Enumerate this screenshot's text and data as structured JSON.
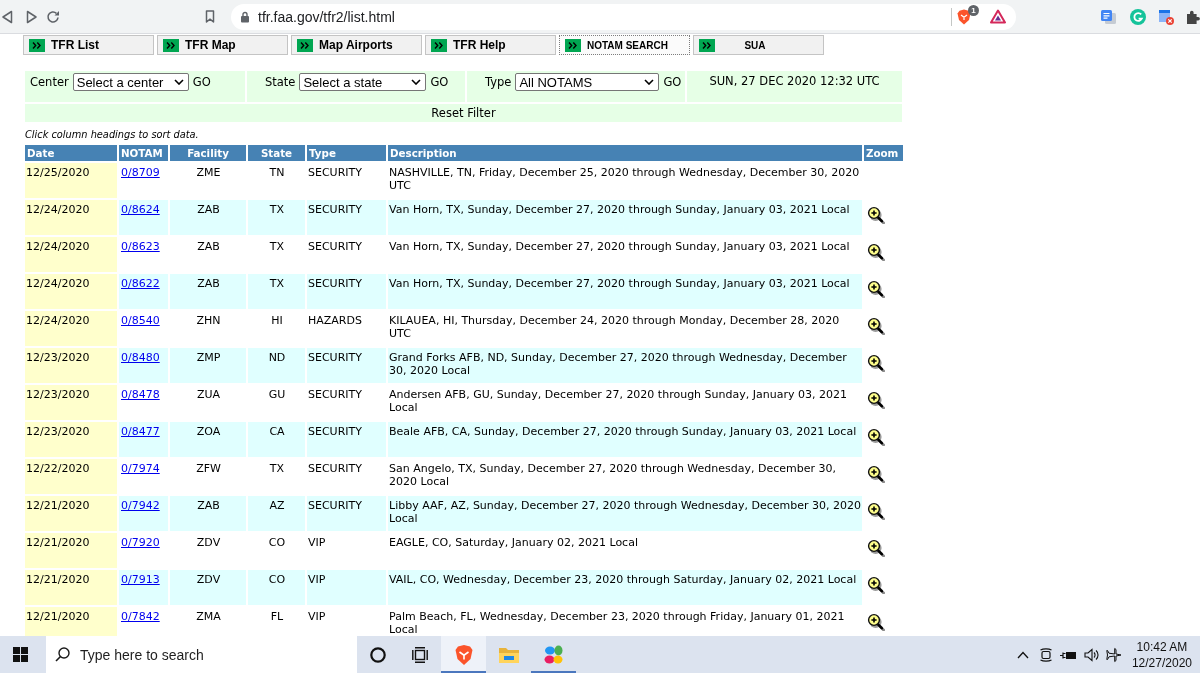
{
  "browser": {
    "url": "tfr.faa.gov/tfr2/list.html",
    "shield_count": "1"
  },
  "nav_tabs": [
    {
      "label": "TFR List",
      "kind": "main",
      "selected": false
    },
    {
      "label": "TFR Map",
      "kind": "main",
      "selected": false
    },
    {
      "label": "Map Airports",
      "kind": "main",
      "selected": false
    },
    {
      "label": "TFR Help",
      "kind": "main",
      "selected": false
    },
    {
      "label": "NOTAM SEARCH",
      "kind": "compact",
      "selected": true
    },
    {
      "label": "SUA",
      "kind": "compact",
      "selected": false
    }
  ],
  "filters": [
    {
      "label": "Center",
      "value": "Select a center",
      "button": "GO"
    },
    {
      "label": "State",
      "value": "Select a state",
      "button": "GO"
    },
    {
      "label": "Type",
      "value": "All NOTAMS",
      "button": "GO"
    }
  ],
  "timestamp": "SUN, 27 DEC 2020 12:32 UTC",
  "reset_button": "Reset Filter",
  "sort_hint": "Click column headings to sort data.",
  "table": {
    "columns": [
      "Date",
      "NOTAM",
      "Facility",
      "State",
      "Type",
      "Description",
      "Zoom"
    ],
    "rows": [
      {
        "date": "12/25/2020",
        "notam": "0/8709",
        "facility": "ZME",
        "state": "TN",
        "type": "SECURITY",
        "description": "NASHVILLE, TN, Friday, December 25, 2020 through Wednesday, December 30, 2020 UTC",
        "zoom": false
      },
      {
        "date": "12/24/2020",
        "notam": "0/8624",
        "facility": "ZAB",
        "state": "TX",
        "type": "SECURITY",
        "description": "Van Horn, TX, Sunday, December 27, 2020 through Sunday, January 03, 2021 Local",
        "zoom": true
      },
      {
        "date": "12/24/2020",
        "notam": "0/8623",
        "facility": "ZAB",
        "state": "TX",
        "type": "SECURITY",
        "description": "Van Horn, TX, Sunday, December 27, 2020 through Sunday, January 03, 2021 Local",
        "zoom": true
      },
      {
        "date": "12/24/2020",
        "notam": "0/8622",
        "facility": "ZAB",
        "state": "TX",
        "type": "SECURITY",
        "description": "Van Horn, TX, Sunday, December 27, 2020 through Sunday, January 03, 2021 Local",
        "zoom": true
      },
      {
        "date": "12/24/2020",
        "notam": "0/8540",
        "facility": "ZHN",
        "state": "HI",
        "type": "HAZARDS",
        "description": "KILAUEA, HI, Thursday, December 24, 2020 through Monday, December 28, 2020 UTC",
        "zoom": true
      },
      {
        "date": "12/23/2020",
        "notam": "0/8480",
        "facility": "ZMP",
        "state": "ND",
        "type": "SECURITY",
        "description": "Grand Forks AFB, ND, Sunday, December 27, 2020 through Wednesday, December 30, 2020 Local",
        "zoom": true
      },
      {
        "date": "12/23/2020",
        "notam": "0/8478",
        "facility": "ZUA",
        "state": "GU",
        "type": "SECURITY",
        "description": "Andersen AFB, GU, Sunday, December 27, 2020 through Sunday, January 03, 2021 Local",
        "zoom": true
      },
      {
        "date": "12/23/2020",
        "notam": "0/8477",
        "facility": "ZOA",
        "state": "CA",
        "type": "SECURITY",
        "description": "Beale AFB, CA, Sunday, December 27, 2020 through Sunday, January 03, 2021 Local",
        "zoom": true
      },
      {
        "date": "12/22/2020",
        "notam": "0/7974",
        "facility": "ZFW",
        "state": "TX",
        "type": "SECURITY",
        "description": "San Angelo, TX, Sunday, December 27, 2020 through Wednesday, December 30, 2020 Local",
        "zoom": true
      },
      {
        "date": "12/21/2020",
        "notam": "0/7942",
        "facility": "ZAB",
        "state": "AZ",
        "type": "SECURITY",
        "description": "Libby AAF, AZ, Sunday, December 27, 2020 through Wednesday, December 30, 2020 Local",
        "zoom": true
      },
      {
        "date": "12/21/2020",
        "notam": "0/7920",
        "facility": "ZDV",
        "state": "CO",
        "type": "VIP",
        "description": "EAGLE, CO, Saturday, January 02, 2021 Local",
        "zoom": true
      },
      {
        "date": "12/21/2020",
        "notam": "0/7913",
        "facility": "ZDV",
        "state": "CO",
        "type": "VIP",
        "description": "VAIL, CO, Wednesday, December 23, 2020 through Saturday, January 02, 2021 Local",
        "zoom": true
      },
      {
        "date": "12/21/2020",
        "notam": "0/7842",
        "facility": "ZMA",
        "state": "FL",
        "type": "VIP",
        "description": "Palm Beach, FL, Wednesday, December 23, 2020 through Friday, January 01, 2021 Local",
        "zoom": true
      }
    ]
  },
  "taskbar": {
    "search_placeholder": "Type here to search",
    "apps": [
      {
        "kind": "lion",
        "selected": true,
        "running": true
      },
      {
        "kind": "folder",
        "selected": false,
        "running": false
      },
      {
        "kind": "petals",
        "selected": false,
        "running": true
      }
    ],
    "time": "10:42 AM",
    "date": "12/27/2020"
  }
}
